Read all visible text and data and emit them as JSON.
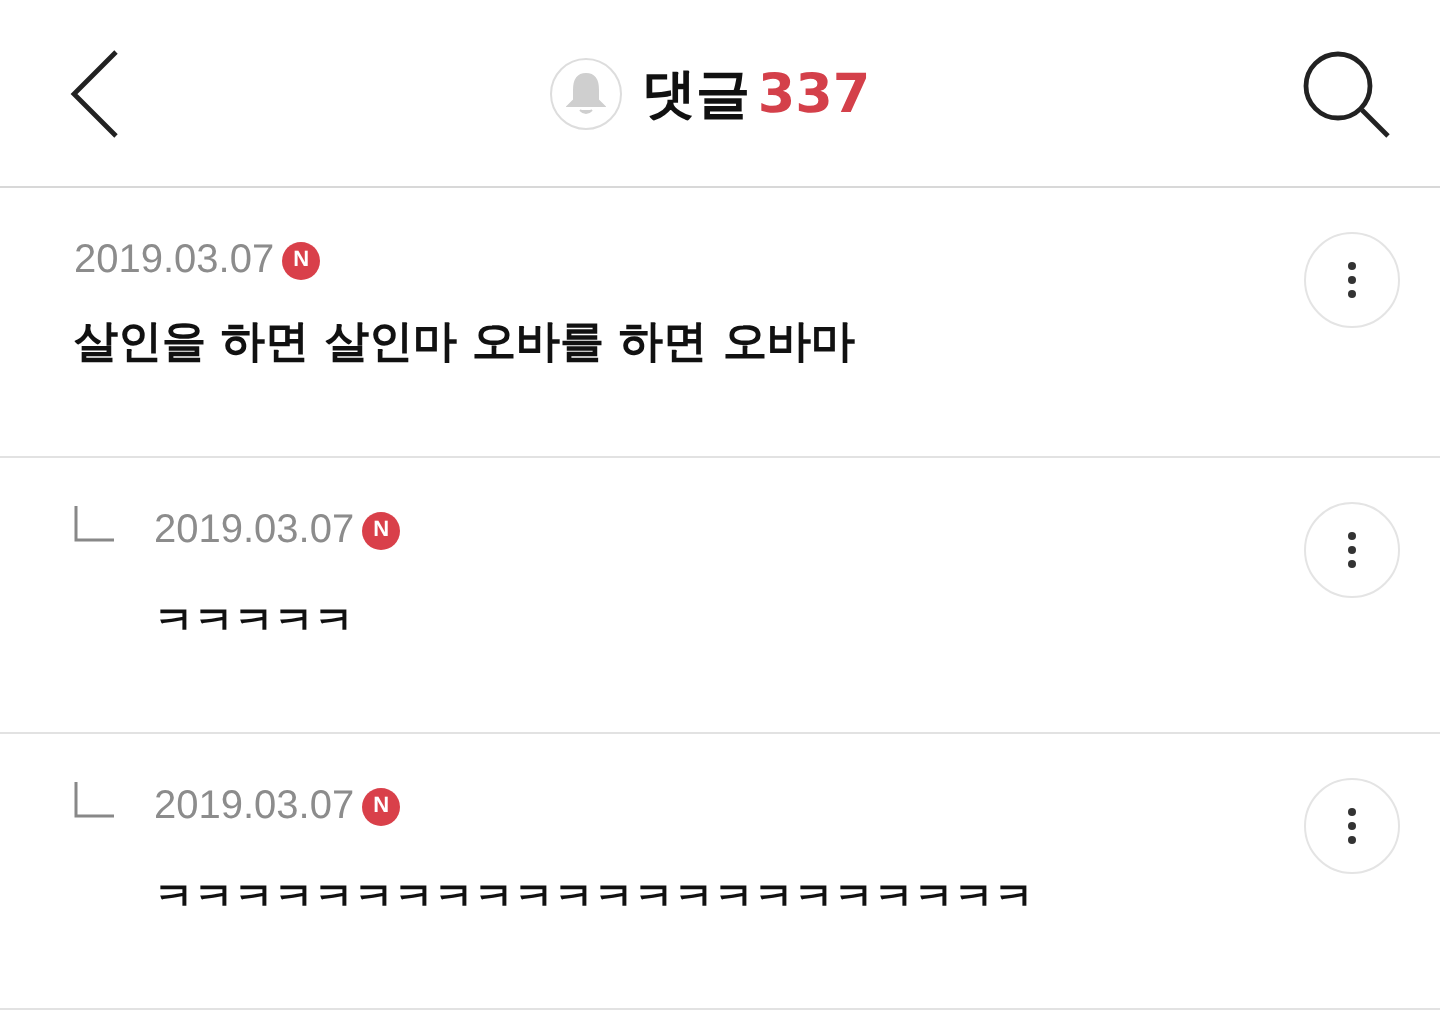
{
  "header": {
    "title": "댓글",
    "count": "337"
  },
  "comments": [
    {
      "reply": false,
      "date": "2019.03.07",
      "badge": "N",
      "text": "살인을 하면 살인마 오바를 하면 오바마"
    },
    {
      "reply": true,
      "date": "2019.03.07",
      "badge": "N",
      "text": "ㅋㅋㅋㅋㅋ"
    },
    {
      "reply": true,
      "date": "2019.03.07",
      "badge": "N",
      "text": "ㅋㅋㅋㅋㅋㅋㅋㅋㅋㅋㅋㅋㅋㅋㅋㅋㅋㅋㅋㅋㅋㅋ"
    }
  ]
}
